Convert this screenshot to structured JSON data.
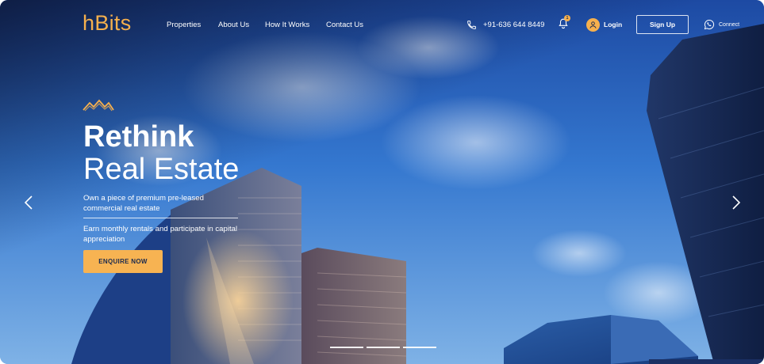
{
  "brand": {
    "logo_text": "hBits",
    "accent_color": "#f6b04d"
  },
  "nav": {
    "items": [
      {
        "label": "Properties"
      },
      {
        "label": "About Us"
      },
      {
        "label": "How It Works"
      },
      {
        "label": "Contact Us"
      }
    ]
  },
  "header": {
    "phone": {
      "icon": "phone-icon",
      "number": "+91-636 644 8449"
    },
    "notifications": {
      "icon": "bell-icon",
      "count": "1"
    },
    "login": {
      "icon": "user-avatar-icon",
      "label": "Login"
    },
    "signup": {
      "label": "Sign Up"
    },
    "connect": {
      "icon": "whatsapp-icon",
      "label": "Connect"
    }
  },
  "hero": {
    "icon": "mountain-icon",
    "headline_bold": "Rethink",
    "headline_light": "Real Estate",
    "description_1": "Own a piece of premium pre-leased commercial real estate",
    "description_2": "Earn monthly rentals and participate in capital appreciation",
    "cta_label": "ENQUIRE NOW",
    "slides": {
      "count": 3
    },
    "prev_icon": "chevron-left-icon",
    "next_icon": "chevron-right-icon"
  }
}
